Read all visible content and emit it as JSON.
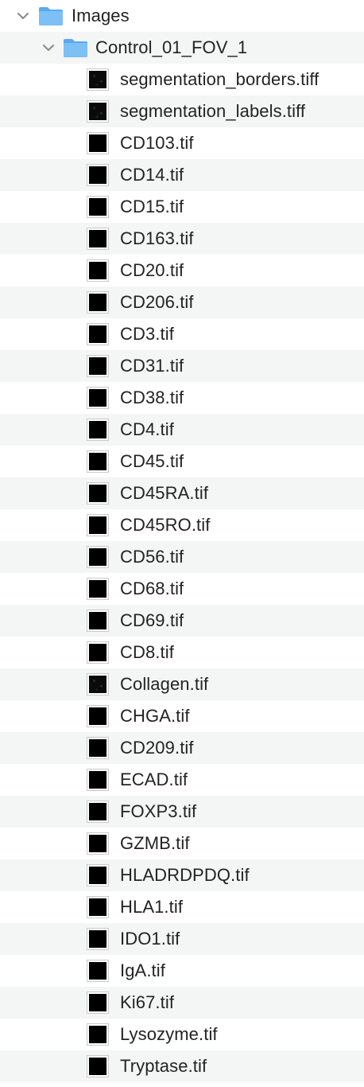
{
  "tree": {
    "root_folder": {
      "label": "Images",
      "icon": "folder-icon",
      "expanded": true
    },
    "sub_folder": {
      "label": "Control_01_FOV_1",
      "icon": "folder-icon",
      "expanded": true
    },
    "files": [
      {
        "label": "segmentation_borders.tiff",
        "thumb": "textured"
      },
      {
        "label": "segmentation_labels.tiff",
        "thumb": "textured"
      },
      {
        "label": "CD103.tif",
        "thumb": "black"
      },
      {
        "label": "CD14.tif",
        "thumb": "black"
      },
      {
        "label": "CD15.tif",
        "thumb": "black"
      },
      {
        "label": "CD163.tif",
        "thumb": "black"
      },
      {
        "label": "CD20.tif",
        "thumb": "black"
      },
      {
        "label": "CD206.tif",
        "thumb": "black"
      },
      {
        "label": "CD3.tif",
        "thumb": "black"
      },
      {
        "label": "CD31.tif",
        "thumb": "black"
      },
      {
        "label": "CD38.tif",
        "thumb": "black"
      },
      {
        "label": "CD4.tif",
        "thumb": "black"
      },
      {
        "label": "CD45.tif",
        "thumb": "black"
      },
      {
        "label": "CD45RA.tif",
        "thumb": "black"
      },
      {
        "label": "CD45RO.tif",
        "thumb": "black"
      },
      {
        "label": "CD56.tif",
        "thumb": "black"
      },
      {
        "label": "CD68.tif",
        "thumb": "black"
      },
      {
        "label": "CD69.tif",
        "thumb": "black"
      },
      {
        "label": "CD8.tif",
        "thumb": "black"
      },
      {
        "label": "Collagen.tif",
        "thumb": "textured"
      },
      {
        "label": "CHGA.tif",
        "thumb": "black"
      },
      {
        "label": "CD209.tif",
        "thumb": "black"
      },
      {
        "label": "ECAD.tif",
        "thumb": "black"
      },
      {
        "label": "FOXP3.tif",
        "thumb": "black"
      },
      {
        "label": "GZMB.tif",
        "thumb": "black"
      },
      {
        "label": "HLADRDPDQ.tif",
        "thumb": "black"
      },
      {
        "label": "HLA1.tif",
        "thumb": "black"
      },
      {
        "label": "IDO1.tif",
        "thumb": "black"
      },
      {
        "label": "IgA.tif",
        "thumb": "black"
      },
      {
        "label": "Ki67.tif",
        "thumb": "black"
      },
      {
        "label": "Lysozyme.tif",
        "thumb": "black"
      },
      {
        "label": "Tryptase.tif",
        "thumb": "black"
      }
    ]
  },
  "colors": {
    "row_alt": "#f4f5f5",
    "folder_fill": "#7cc0f5",
    "folder_tab": "#5aa9ec",
    "text": "#232323",
    "chevron": "#8a8a8a"
  }
}
